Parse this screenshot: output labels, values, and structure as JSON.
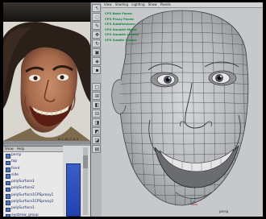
{
  "viewport": {
    "menu": [
      "View",
      "Shading",
      "Lighting",
      "Show",
      "Panels"
    ],
    "hud": [
      "CPS Base Faces:",
      "CPS Proxy Faces:",
      "CPS Subdivisions:",
      "CPS Smooth Mode:",
      "CPS Smooth Levels:",
      "CPS Subdiv Shape:"
    ],
    "camera": "persp"
  },
  "outliner": {
    "menu": [
      "Show",
      "Help"
    ],
    "items": [
      "persp",
      "top",
      "front",
      "side",
      "polySurface1",
      "polySurface2",
      "polySurface1CPSproxy1",
      "polySurface1CPSproxy2",
      "polySurface1",
      "eyebrow_group",
      "defaultLightSet",
      "defaultObjectSet"
    ]
  },
  "side_window": {
    "readout": "0.1 56.7 0.3"
  },
  "colors": {
    "viewport_bg": "#c6c8ca",
    "hud_text": "#0a8a3a",
    "outliner_text": "#1d2a66",
    "channel_blue": "#2a4bb8"
  },
  "toolbox": {
    "tools": [
      "select-arrow-icon",
      "lasso-icon",
      "paint-select-icon",
      "move-icon",
      "rotate-icon",
      "scale-icon",
      "manipulator-icon",
      "last-tool-icon",
      "layout-single-icon",
      "layout-four-icon",
      "layout-side-icon",
      "layout-stack-icon",
      "layout-persp-outliner-icon",
      "layout-persp-graph-icon",
      "layout-hypershade-icon",
      "layout-custom-icon"
    ]
  }
}
